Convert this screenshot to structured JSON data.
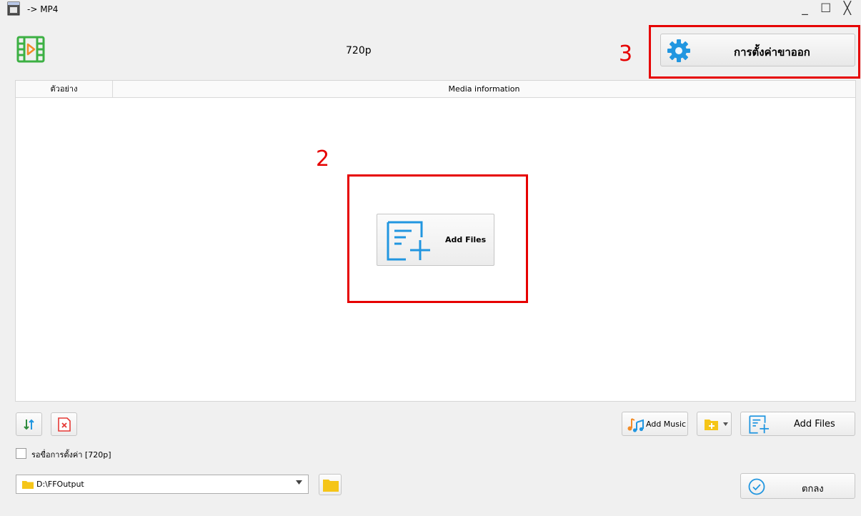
{
  "window": {
    "title": "-> MP4",
    "controls": {
      "minimize": "_",
      "maximize": "☐",
      "close": "╳"
    }
  },
  "header": {
    "preset": "720p",
    "settings_button": "การตั้งค่าขาออก"
  },
  "annotations": {
    "step2": "2",
    "step3": "3"
  },
  "list": {
    "columns": [
      "ตัวอย่าง",
      "Media information"
    ],
    "center_add_files": "Add Files"
  },
  "toolbar": {
    "add_music": "Add Music",
    "add_files": "Add Files"
  },
  "wait_option": {
    "label": "รอขื่อการตั้งค่า [720p]",
    "checked": false
  },
  "output": {
    "path": "D:\\FFOutput"
  },
  "ok_button": "ตกลง",
  "colors": {
    "accent_blue": "#2196e0",
    "film_green": "#3cb043",
    "annotation_red": "#e60000",
    "remove_red": "#e53935",
    "folder_yellow": "#f5c518"
  }
}
